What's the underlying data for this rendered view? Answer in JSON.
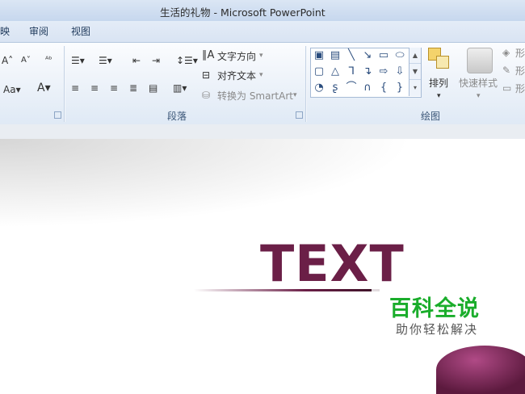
{
  "window": {
    "title": "生活的礼物 - Microsoft PowerPoint"
  },
  "menu": {
    "items": [
      "映",
      "审阅",
      "视图"
    ]
  },
  "ribbon": {
    "paragraph": {
      "label": "段落",
      "text_direction": "文字方向",
      "align_text": "对齐文本",
      "convert_smartart": "转换为 SmartArt"
    },
    "drawing": {
      "label": "绘图",
      "arrange": "排列",
      "quick_styles": "快速样式",
      "right_cut_1": "形",
      "right_cut_2": "形",
      "right_cut_3": "形"
    }
  },
  "slide": {
    "text": "TEXT",
    "text_color": "#6b1f47"
  },
  "watermark": {
    "title": "百科全说",
    "subtitle": "助你轻松解决",
    "color": "#1aad2b"
  }
}
